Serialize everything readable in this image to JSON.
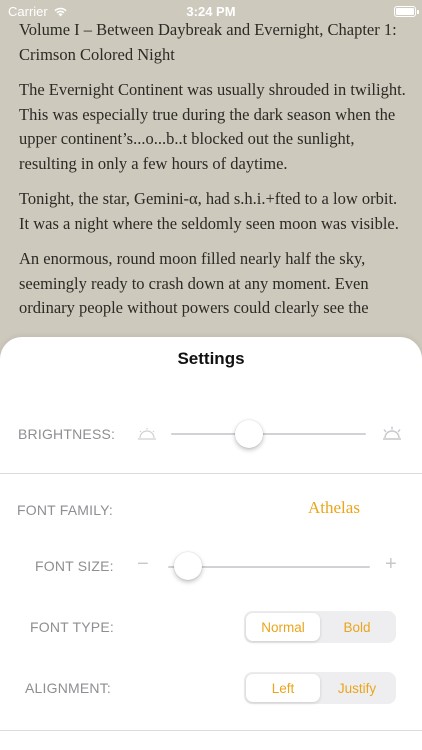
{
  "status_bar": {
    "carrier": "Carrier",
    "time": "3:24 PM"
  },
  "reader": {
    "paragraphs": [
      "Volume I – Between Daybreak and Evernight, Chapter 1: Crimson Colored Night",
      "The Evernight Continent was usually shrouded in twilight. This was especially true during the dark season when the upper continent’s...o...b..t blocked out the sunlight, resulting in only a few hours of daytime.",
      "Tonight, the star, Gemini-α, had s.h.i.+fted to a low orbit. It was a night where the seldomly seen moon was visible.",
      "An enormous, round moon filled nearly half the sky, seemingly ready to crash down at any moment. Even ordinary people without powers could clearly see the"
    ]
  },
  "settings": {
    "title": "Settings",
    "brightness": {
      "label": "BRIGHTNESS:",
      "level": 0.4
    },
    "font_family": {
      "label": "FONT FAMILY:",
      "value": "Athelas"
    },
    "font_size": {
      "label": "FONT SIZE:",
      "level": 0.1
    },
    "font_type": {
      "label": "FONT TYPE:",
      "options": [
        "Normal",
        "Bold"
      ],
      "selected": "Normal"
    },
    "alignment": {
      "label": "ALIGNMENT:",
      "options": [
        "Left",
        "Justify"
      ],
      "selected": "Left"
    }
  },
  "colors": {
    "accent": "#eaa51b",
    "page_background": "#cdc9bd",
    "label_gray": "#8e8e93"
  }
}
